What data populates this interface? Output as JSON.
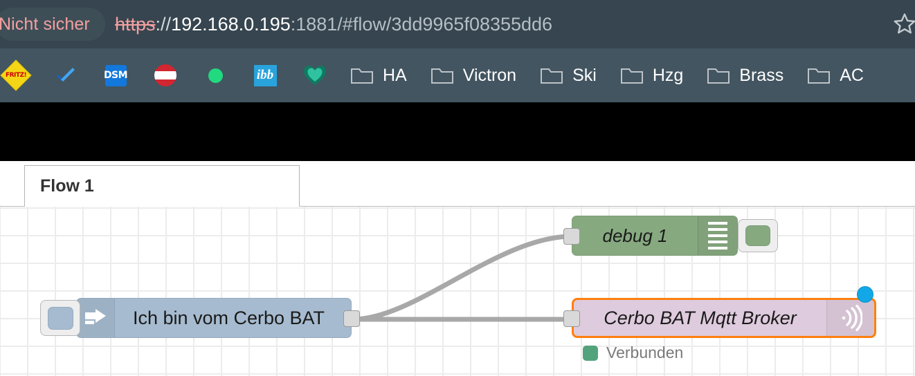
{
  "browser": {
    "security_badge": "Nicht sicher",
    "url": {
      "scheme": "https",
      "separator": "://",
      "host": "192.168.0.195",
      "rest": ":1881/#flow/3dd9965f08355dd6",
      "full": "https://192.168.0.195:1881/#flow/3dd9965f08355dd6"
    },
    "bookmark_star_icon": "star-outline-icon",
    "toolbar_color": "#36454f",
    "bookmarks_bar_color": "#435560",
    "insecure_text_color": "#f4a0a0"
  },
  "bookmarks": [
    {
      "icon": "fritzbox-icon",
      "icon_text": "FRITZ!",
      "label": "",
      "type": "site"
    },
    {
      "icon": "blue-checkmark-icon",
      "icon_text": "",
      "label": "",
      "type": "site"
    },
    {
      "icon": "dsm-icon",
      "icon_text": "DSM",
      "label": "",
      "type": "site"
    },
    {
      "icon": "austria-flag-icon",
      "icon_text": "",
      "label": "",
      "type": "site"
    },
    {
      "icon": "green-dot-icon",
      "icon_text": "",
      "label": "",
      "type": "site"
    },
    {
      "icon": "ibb-icon",
      "icon_text": "ibb",
      "label": "",
      "type": "site"
    },
    {
      "icon": "teal-heart-icon",
      "icon_text": "",
      "label": "",
      "type": "site"
    },
    {
      "icon": "folder-icon",
      "icon_text": "",
      "label": "HA",
      "type": "folder"
    },
    {
      "icon": "folder-icon",
      "icon_text": "",
      "label": "Victron",
      "type": "folder"
    },
    {
      "icon": "folder-icon",
      "icon_text": "",
      "label": "Ski",
      "type": "folder"
    },
    {
      "icon": "folder-icon",
      "icon_text": "",
      "label": "Hzg",
      "type": "folder"
    },
    {
      "icon": "folder-icon",
      "icon_text": "",
      "label": "Brass",
      "type": "folder"
    },
    {
      "icon": "folder-icon",
      "icon_text": "",
      "label": "AC",
      "type": "folder"
    }
  ],
  "editor": {
    "active_tab": "Flow 1",
    "canvas_grid_color": "#ececec",
    "nodes": {
      "inject": {
        "label": "Ich bin vom Cerbo BAT",
        "color": "#a6bbcf",
        "icon": "inject-arrow-icon",
        "button_icon": "inject-trigger-button"
      },
      "debug": {
        "label": "debug 1",
        "color": "#87a980",
        "icon": "debug-lines-icon",
        "toggle_icon": "debug-enable-toggle"
      },
      "mqtt": {
        "label": "Cerbo BAT Mqtt Broker",
        "color": "#decbdd",
        "selection_color": "#ff7f0e",
        "icon": "mqtt-antenna-icon",
        "badge_icon": "blue-changed-dot",
        "status_text": "Verbunden",
        "status_color": "#52a37c"
      }
    }
  }
}
